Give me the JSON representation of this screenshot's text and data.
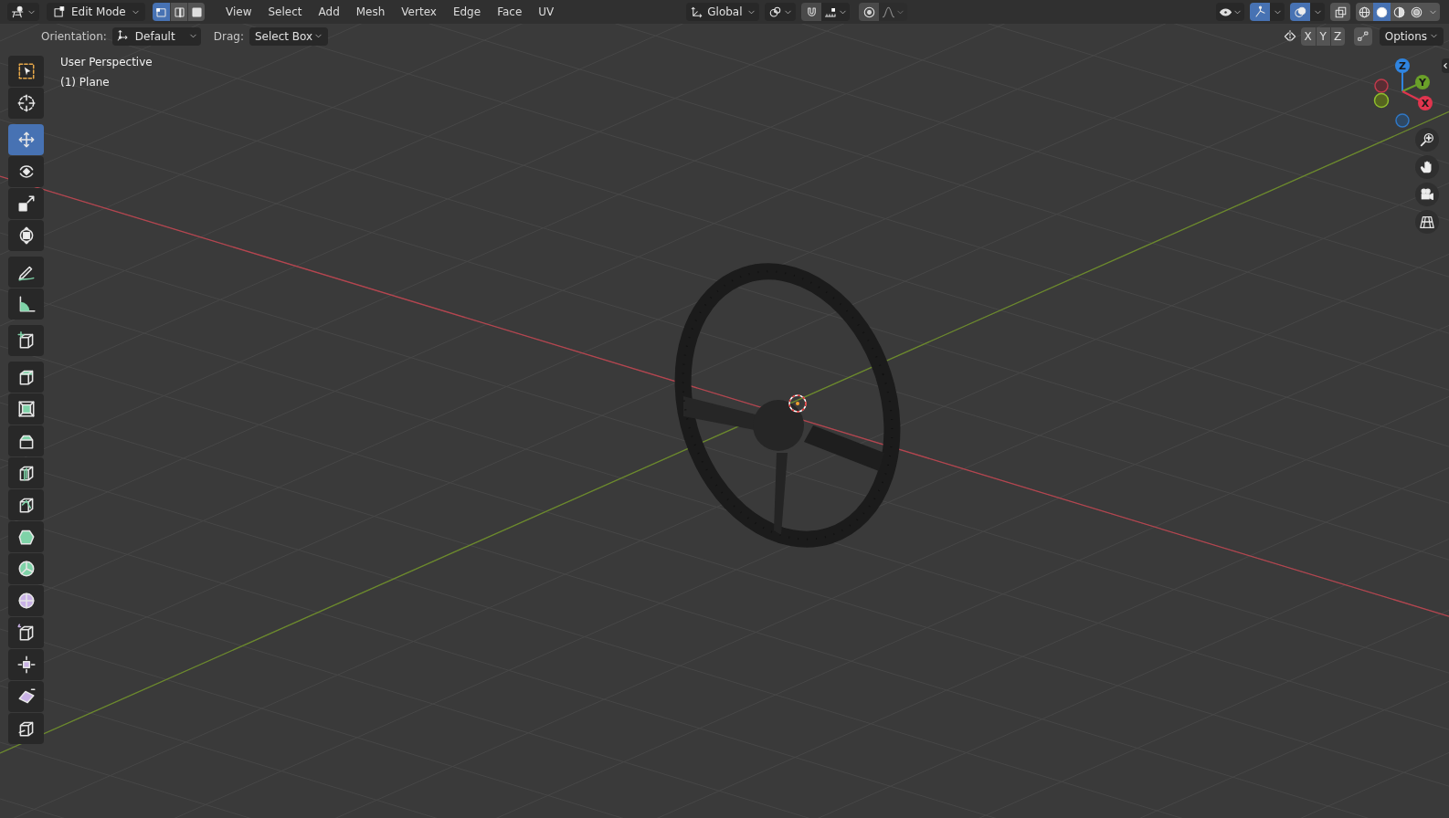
{
  "header": {
    "mode": "Edit Mode",
    "select_modes": [
      {
        "kind": "vertex",
        "selected": true
      },
      {
        "kind": "edge",
        "selected": false
      },
      {
        "kind": "face",
        "selected": false
      }
    ],
    "menus": [
      "View",
      "Select",
      "Add",
      "Mesh",
      "Vertex",
      "Edge",
      "Face",
      "UV"
    ],
    "orientation": "Global",
    "snapping": {
      "on": false
    },
    "proportional_editing": {
      "on": false
    },
    "gizmos": {
      "on": true
    },
    "overlays": {
      "on": true
    },
    "xray": {
      "on": false
    },
    "shading_modes": [
      {
        "kind": "wireframe",
        "selected": false
      },
      {
        "kind": "solid",
        "selected": true
      },
      {
        "kind": "material",
        "selected": false
      },
      {
        "kind": "rendered",
        "selected": false
      }
    ]
  },
  "tool_settings": {
    "orientation_label": "Orientation:",
    "orientation": "Default",
    "drag_label": "Drag:",
    "drag": "Select Box",
    "mirror_axes": [
      {
        "label": "X",
        "on": false
      },
      {
        "label": "Y",
        "on": false
      },
      {
        "label": "Z",
        "on": false
      }
    ],
    "options": "Options"
  },
  "viewport": {
    "view_name": "User Perspective",
    "object_name": "(1) Plane",
    "nav_gizmo": {
      "axes": [
        "Z",
        "Y",
        "X"
      ]
    }
  },
  "toolbar": {
    "groups": [
      [
        {
          "kind": "select_box",
          "selected": false
        },
        {
          "kind": "cursor",
          "selected": false
        }
      ],
      [
        {
          "kind": "move",
          "selected": true
        },
        {
          "kind": "rotate",
          "selected": false
        },
        {
          "kind": "scale",
          "selected": false
        },
        {
          "kind": "transform",
          "selected": false
        }
      ],
      [
        {
          "kind": "annotate",
          "selected": false
        },
        {
          "kind": "measure",
          "selected": false
        }
      ],
      [
        {
          "kind": "add_cube",
          "selected": false
        }
      ],
      [
        {
          "kind": "extrude",
          "selected": false
        },
        {
          "kind": "inset",
          "selected": false
        },
        {
          "kind": "bevel",
          "selected": false
        },
        {
          "kind": "loop_cut",
          "selected": false
        },
        {
          "kind": "knife",
          "selected": false
        },
        {
          "kind": "poly_build",
          "selected": false
        },
        {
          "kind": "spin",
          "selected": false
        },
        {
          "kind": "smooth",
          "selected": false
        },
        {
          "kind": "edge_slide",
          "selected": false
        },
        {
          "kind": "shrink",
          "selected": false
        },
        {
          "kind": "shear",
          "selected": false
        },
        {
          "kind": "rip",
          "selected": false
        }
      ]
    ]
  }
}
